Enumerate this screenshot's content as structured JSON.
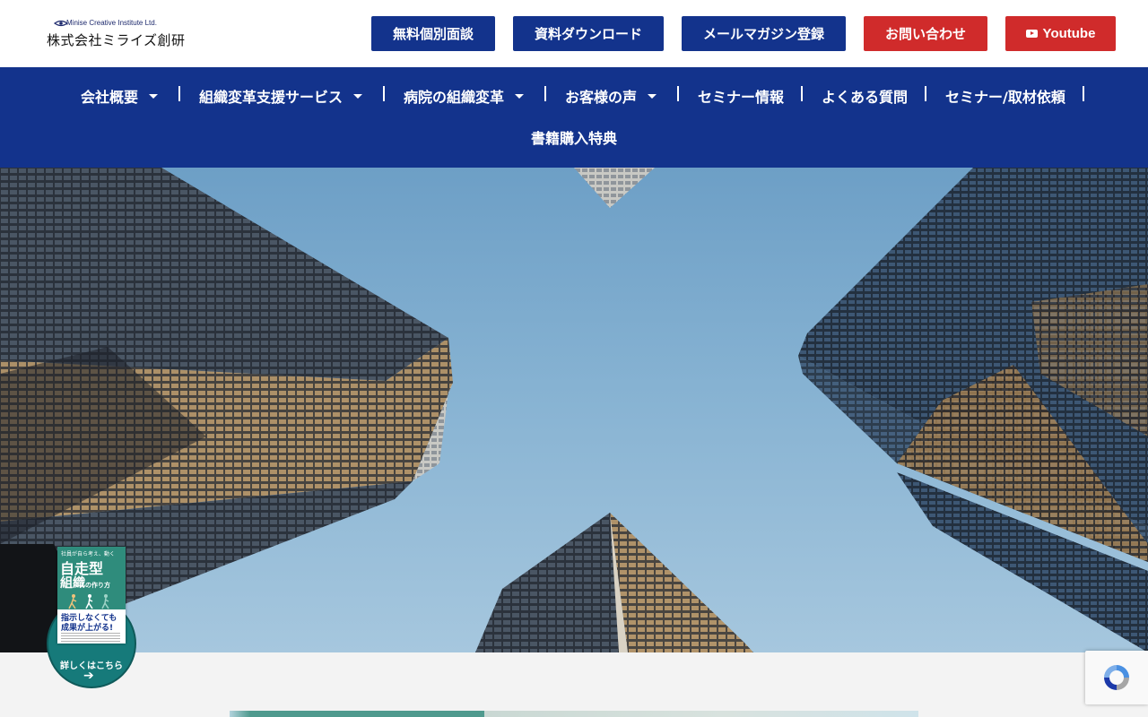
{
  "header": {
    "logo": {
      "english": "Minise Creative Institute Ltd.",
      "japanese": "株式会社ミライズ創研"
    },
    "buttons": [
      {
        "label": "無料個別面談",
        "style": "navy"
      },
      {
        "label": "資料ダウンロード",
        "style": "navy"
      },
      {
        "label": "メールマガジン登録",
        "style": "navy"
      },
      {
        "label": "お問い合わせ",
        "style": "red"
      },
      {
        "label": "Youtube",
        "style": "red",
        "icon": "youtube-icon"
      }
    ]
  },
  "nav": {
    "items": [
      {
        "label": "会社概要",
        "has_dropdown": true
      },
      {
        "label": "組織変革支援サービス",
        "has_dropdown": true
      },
      {
        "label": "病院の組織変革",
        "has_dropdown": true
      },
      {
        "label": "お客様の声",
        "has_dropdown": true
      },
      {
        "label": "セミナー情報",
        "has_dropdown": false
      },
      {
        "label": "よくある質問",
        "has_dropdown": false
      },
      {
        "label": "セミナー/取材依頼",
        "has_dropdown": false
      },
      {
        "label": "書籍購入特典",
        "has_dropdown": false
      }
    ]
  },
  "hero": {
    "image": "skyscrapers-looking-up"
  },
  "promo": {
    "book_kicker": "社員が自ら考え、動く",
    "book_title_line1": "自走型",
    "book_title_line2": "組織",
    "book_title_suffix": "の作り方",
    "book_copy_line1": "指示しなくても",
    "book_copy_line2": "成果が上がる!",
    "cta_label": "詳しくはこちら",
    "cta_icon": "arrow-right-icon"
  },
  "colors": {
    "navy": "#13338c",
    "red": "#d02b2b",
    "teal": "#167a7a",
    "page_background": "#f3f3f3"
  }
}
